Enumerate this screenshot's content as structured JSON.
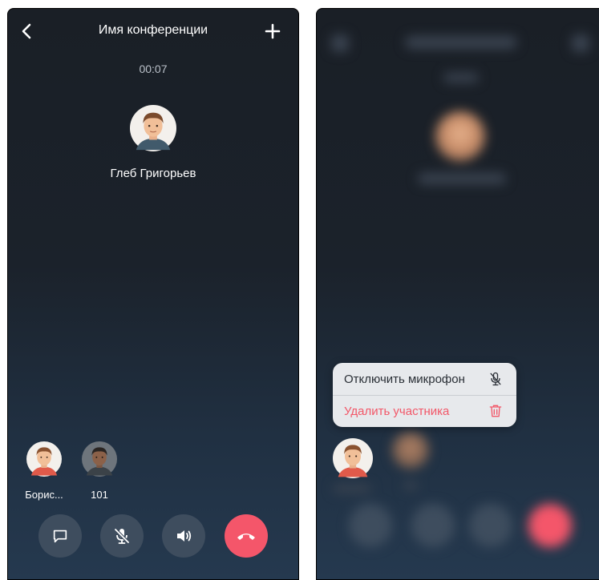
{
  "left_screen": {
    "title": "Имя конференции",
    "timer": "00:07",
    "active_speaker": {
      "name": "Глеб Григорьев"
    },
    "participants": [
      {
        "name": "Борис..."
      },
      {
        "name": "101"
      }
    ],
    "controls": [
      "chat-icon",
      "mic-off-icon",
      "speaker-icon",
      "hangup-icon"
    ]
  },
  "right_screen": {
    "context_menu": {
      "mute_label": "Отключить микрофон",
      "remove_label": "Удалить участника"
    }
  },
  "colors": {
    "background_top": "#1a1f26",
    "background_bottom": "#25394f",
    "control_button": "#3e4d5e",
    "hangup": "#f4566a",
    "menu_bg": "#e7e9ec",
    "danger_text": "#f25768"
  }
}
